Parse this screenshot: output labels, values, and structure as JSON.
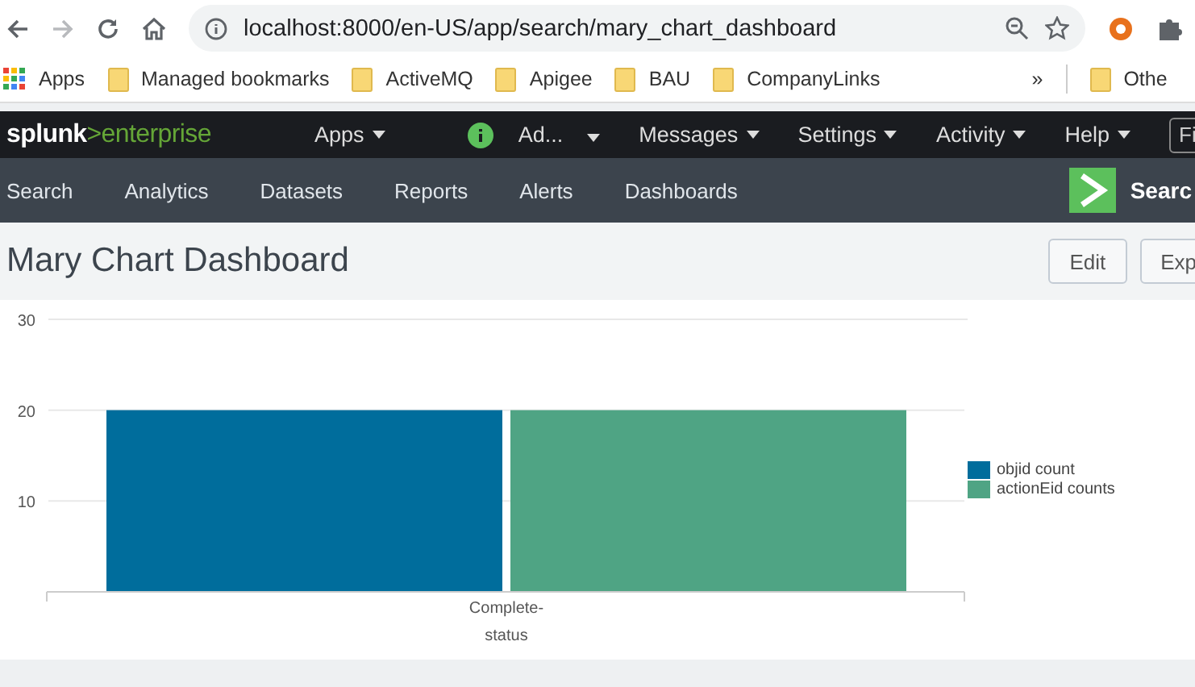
{
  "browser": {
    "url": "localhost:8000/en-US/app/search/mary_chart_dashboard"
  },
  "bookmarks": {
    "items": [
      {
        "label": "Apps",
        "kind": "apps"
      },
      {
        "label": "Managed bookmarks",
        "kind": "folder"
      },
      {
        "label": "ActiveMQ",
        "kind": "folder"
      },
      {
        "label": "Apigee",
        "kind": "folder"
      },
      {
        "label": "BAU",
        "kind": "folder"
      },
      {
        "label": "CompanyLinks",
        "kind": "folder"
      }
    ],
    "overflow": "»",
    "other": "Othe"
  },
  "splunk_bar": {
    "brand": "splunk",
    "product": ">enterprise",
    "menus": [
      {
        "label": "Apps",
        "kind": "left"
      },
      {
        "label": "Ad...",
        "kind": "user"
      },
      {
        "label": "Messages",
        "kind": "right"
      },
      {
        "label": "Settings",
        "kind": "right"
      },
      {
        "label": "Activity",
        "kind": "right"
      },
      {
        "label": "Help",
        "kind": "right"
      }
    ],
    "search_field": {
      "placeholder": "Fi"
    }
  },
  "app_bar": {
    "tabs": [
      "Search",
      "Analytics",
      "Datasets",
      "Reports",
      "Alerts",
      "Dashboards"
    ],
    "app_title": "Searc"
  },
  "dashboard": {
    "title": "Mary Chart Dashboard",
    "buttons": [
      "Edit",
      "Exp"
    ],
    "chart_data": {
      "type": "bar",
      "categories": [
        "Complete-status"
      ],
      "series": [
        {
          "name": "objid count",
          "color": "#006d9c",
          "values": [
            20
          ]
        },
        {
          "name": "actionEid counts",
          "color": "#4fa484",
          "values": [
            20
          ]
        }
      ],
      "ylim": [
        0,
        30
      ],
      "yticks": [
        10,
        20,
        30
      ]
    }
  }
}
